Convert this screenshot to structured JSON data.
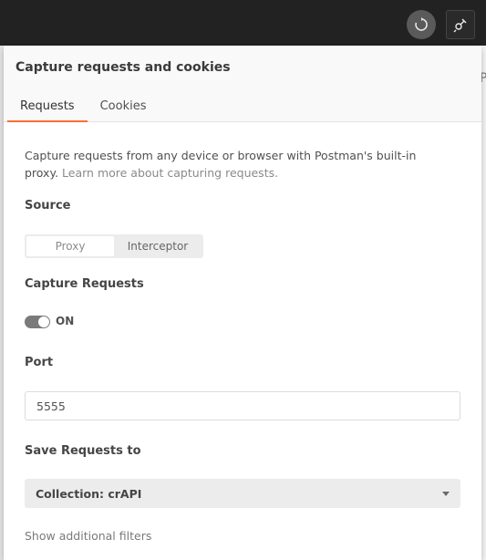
{
  "topbar": {
    "sync_icon": "sync-icon",
    "capture_icon": "satellite-icon"
  },
  "background": {
    "partial_letter": "P"
  },
  "panel": {
    "title": "Capture requests and cookies",
    "tabs": [
      {
        "label": "Requests",
        "active": true
      },
      {
        "label": "Cookies",
        "active": false
      }
    ],
    "description": "Capture requests from any device or browser with Postman's built-in proxy.",
    "learn_more": "Learn more about capturing requests.",
    "source": {
      "label": "Source",
      "options": [
        "Proxy",
        "Interceptor"
      ],
      "selected": "Proxy"
    },
    "capture_requests": {
      "label": "Capture Requests",
      "toggle_state": "ON"
    },
    "port": {
      "label": "Port",
      "value": "5555"
    },
    "save_requests": {
      "label": "Save Requests to",
      "selected": "Collection: crAPI"
    },
    "filters_link": "Show additional filters"
  },
  "colors": {
    "accent": "#ff6c37",
    "topbar": "#222222"
  }
}
